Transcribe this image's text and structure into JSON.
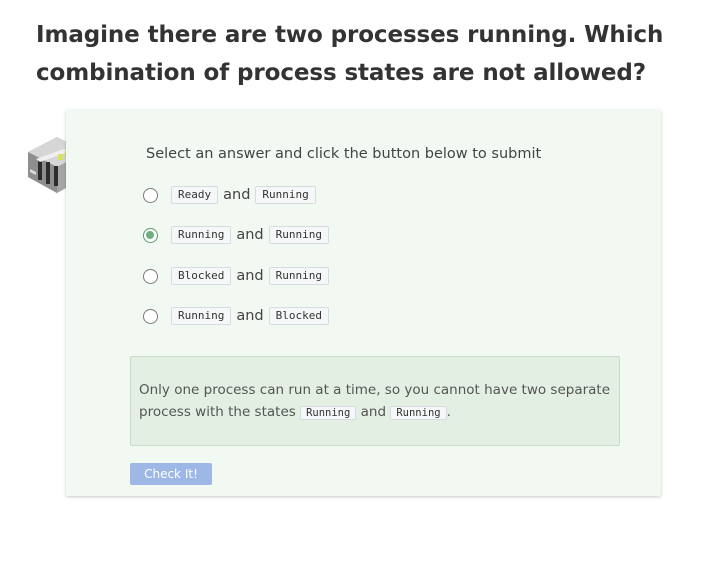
{
  "question": {
    "title": "Imagine there are two processes running. Which combination of process states are not allowed?"
  },
  "quiz": {
    "icon": "isometric-quiz-blocks-icon",
    "instructions": "Select an answer and click the button below to submit",
    "conjunction": "and",
    "options": [
      {
        "first": "Ready",
        "second": "Running",
        "selected": false
      },
      {
        "first": "Running",
        "second": "Running",
        "selected": true
      },
      {
        "first": "Blocked",
        "second": "Running",
        "selected": false
      },
      {
        "first": "Running",
        "second": "Blocked",
        "selected": false
      }
    ],
    "feedback": {
      "text_before": "Only one process can run at a time, so you cannot have two separate process with the states",
      "code1": "Running",
      "conj": "and",
      "code2": "Running",
      "text_after": "."
    },
    "button_label": "Check It!"
  },
  "colors": {
    "card_background": "#f2f8f2",
    "feedback_background": "#e3efe3",
    "radio_selected": "#6fae7e",
    "button_background": "#9db8e6"
  }
}
